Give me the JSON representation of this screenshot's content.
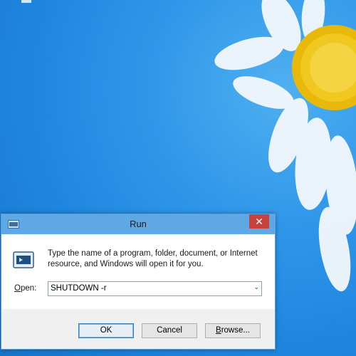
{
  "run_dialog": {
    "title": "Run",
    "close_glyph": "✕",
    "description": "Type the name of a program, folder, document, or Internet resource, and Windows will open it for you.",
    "open_label_underlined": "O",
    "open_label_rest": "pen:",
    "command_value": "SHUTDOWN -r",
    "dropdown_glyph": "⌄",
    "ok_label": "OK",
    "cancel_label": "Cancel",
    "browse_label_underlined": "B",
    "browse_label_rest": "rowse..."
  },
  "colors": {
    "desktop_blue": "#1f86df",
    "titlebar_blue": "#5ea8e6",
    "close_red": "#c7423a",
    "highlight_red": "#e0161e"
  },
  "icons": {
    "titlebar": "run-app-icon",
    "dialog": "run-program-icon",
    "close": "close-icon",
    "dropdown": "chevron-down-icon"
  }
}
